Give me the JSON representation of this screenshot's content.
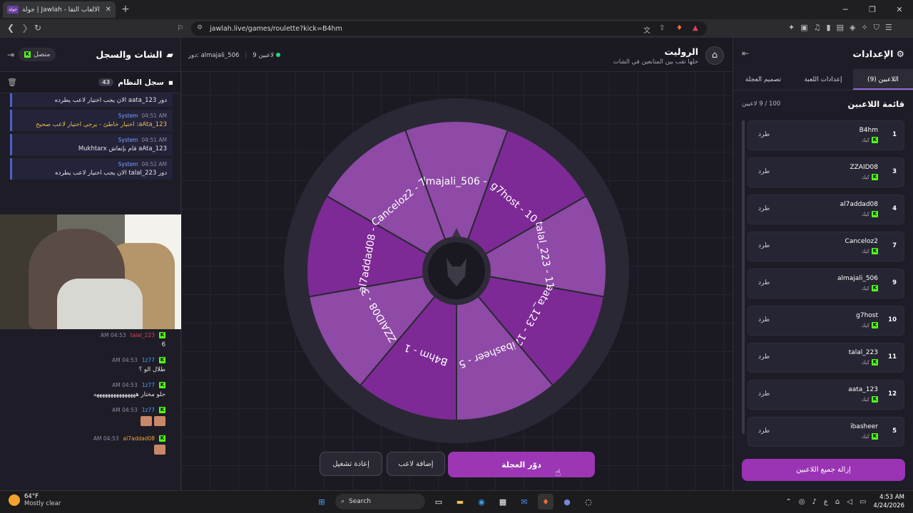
{
  "browser": {
    "tab_title": "جولة | Jawlah - منصة الألعاب التفا",
    "tab_favicon": "جولة",
    "url": "jawlah.live/games/roulette?kick=B4hm"
  },
  "chat": {
    "title": "الشات والسجل",
    "status": "متصل",
    "system_log_title": "سجل النظام",
    "system_log_count": "43",
    "system_messages": [
      {
        "text": "دور aata_123 الان يجب اختيار لاعب يطرده"
      },
      {
        "sender": "System",
        "time": "04:51 AM",
        "text": "aAta_123: اختيار خاطئ - يرجى اختيار لاعب صحيح"
      },
      {
        "sender": "System",
        "time": "04:51 AM",
        "text": "aAta_123 قام بإنعاش Mukhtarx"
      },
      {
        "sender": "System",
        "time": "04:52 AM",
        "text": "دور talal_223 الان يجب اختيار لاعب يطرده"
      }
    ],
    "user_messages": [
      {
        "user": "talal_223",
        "time": "04:53 AM",
        "text": "6"
      },
      {
        "user": "1z77",
        "time": "04:53 AM",
        "text": "طلال الو ؟"
      },
      {
        "user": "1z77",
        "time": "04:53 AM",
        "text": "حلو مختار هههههههههههههههه"
      },
      {
        "user": "1z77",
        "time": "04:53 AM",
        "text": ""
      },
      {
        "user": "al7addad08",
        "time": "04:53 AM",
        "text": ""
      }
    ]
  },
  "game": {
    "title": "الروليت",
    "subtitle": "خلها تقب بين المتابعين في الشات",
    "players_count": "9 لاعبين",
    "turn": "دور: almajali_506",
    "wheel_segments": [
      "almajali_506 - 9",
      "g7host - 10",
      "talal_223 - 11",
      "aata_123 - 12",
      "ibasheer - 5",
      "B4hm - 1",
      "ZZAID08 - 3",
      "al7addad08 - 4",
      "Canceloz2 - 7"
    ],
    "spin_button": "دوّر العجلة",
    "add_player_button": "إضافة لاعب",
    "restart_button": "إعادة تشغيل"
  },
  "settings": {
    "title": "الإعدادات",
    "tabs": [
      "اللاعبين (9)",
      "إعدادات اللعبة",
      "تصميم العجلة"
    ],
    "list_title": "قائمة اللاعبين",
    "list_count": "100 / 9 لاعبين",
    "platform_label": "كيك",
    "kick_label": "طرد",
    "players": [
      {
        "num": "1",
        "name": "B4hm"
      },
      {
        "num": "3",
        "name": "ZZAID08"
      },
      {
        "num": "4",
        "name": "al7addad08"
      },
      {
        "num": "7",
        "name": "Canceloz2"
      },
      {
        "num": "9",
        "name": "almajali_506"
      },
      {
        "num": "10",
        "name": "g7host"
      },
      {
        "num": "11",
        "name": "talal_223"
      },
      {
        "num": "12",
        "name": "aata_123"
      },
      {
        "num": "5",
        "name": "ibasheer"
      }
    ],
    "remove_all": "إزالة جميع اللاعبين"
  },
  "taskbar": {
    "temp": "64°F",
    "weather": "Mostly clear",
    "search": "Search",
    "time": "4:53 AM",
    "date": "4/24/2026"
  },
  "colors": {
    "accent": "#9c36b5",
    "wheel_dark": "#7d2a96",
    "wheel_light": "#8e4aa6"
  }
}
